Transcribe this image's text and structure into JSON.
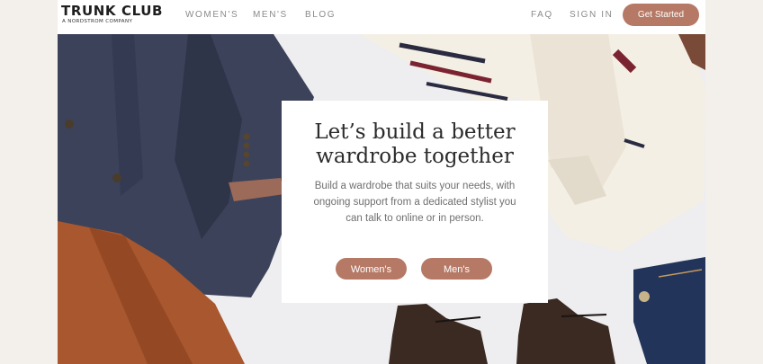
{
  "header": {
    "logo": {
      "name": "TRUNK CLUB",
      "tagline": "A NORDSTROM COMPANY"
    },
    "nav_left": [
      "WOMEN'S",
      "MEN'S",
      "BLOG"
    ],
    "nav_right": [
      "FAQ",
      "SIGN IN"
    ],
    "cta_label": "Get Started"
  },
  "hero": {
    "headline": "Let’s build a better\nwardrobe together",
    "body": "Build a wardrobe that suits your needs, with ongoing support from a dedicated stylist you can talk to online or in person.",
    "buttons": [
      "Women's",
      "Men's"
    ]
  },
  "colors": {
    "accent": "#b57965",
    "page_bg": "#f3efeb",
    "hero_bg": "#eeedef"
  },
  "illustrations": [
    "navy-blazer",
    "cable-knit-sweater",
    "corduroy-pants",
    "leather-boots",
    "denim-jeans"
  ]
}
